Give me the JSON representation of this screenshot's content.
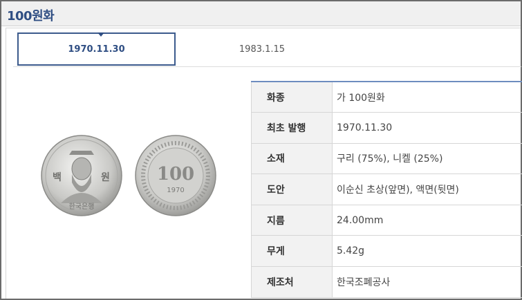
{
  "header": {
    "title": "100원화"
  },
  "tabs": [
    {
      "label": "1970.11.30",
      "active": true
    },
    {
      "label": "1983.1.15",
      "active": false
    }
  ],
  "coin": {
    "front_text_left": "백",
    "front_text_right": "원",
    "front_text_bottom": "한국은행",
    "back_value": "100",
    "back_year": "1970"
  },
  "spec": {
    "rows": [
      {
        "key": "화종",
        "value": "가 100원화"
      },
      {
        "key": "최초 발행",
        "value": "1970.11.30"
      },
      {
        "key": "소재",
        "value": "구리 (75%), 니켈 (25%)"
      },
      {
        "key": "도안",
        "value": "이순신 초상(앞면), 액면(뒷면)"
      },
      {
        "key": "지름",
        "value": "24.00mm"
      },
      {
        "key": "무게",
        "value": "5.42g"
      },
      {
        "key": "제조처",
        "value": "한국조폐공사"
      }
    ]
  },
  "colors": {
    "accent": "#2f4e83",
    "table_border": "#6d8cbf"
  }
}
